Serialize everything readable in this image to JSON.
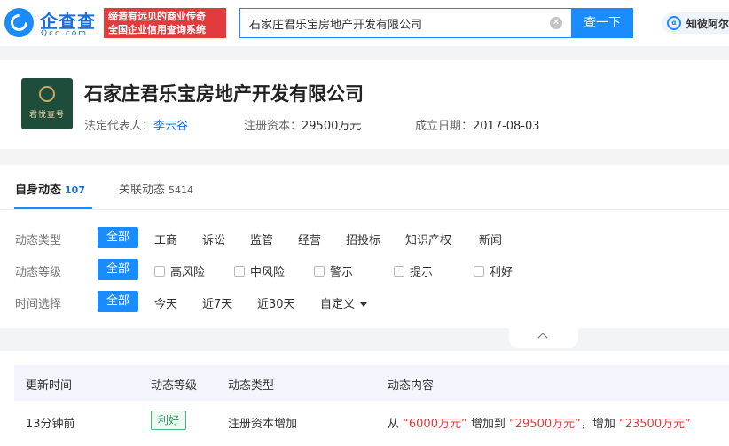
{
  "header": {
    "logo_cn": "企查查",
    "logo_en": "Qcc.com",
    "slogan_line1": "缔造有远见的商业传奇",
    "slogan_line2": "全国企业信用查询系统",
    "search_value": "石家庄君乐宝房地产开发有限公司",
    "search_button": "查一下",
    "zhibi_label": "知彼阿尔法"
  },
  "company": {
    "logo_text": "君悦壹号",
    "name": "石家庄君乐宝房地产开发有限公司",
    "legal_rep_label": "法定代表人：",
    "legal_rep": "李云谷",
    "capital_label": "注册资本：",
    "capital": "29500万元",
    "founded_label": "成立日期：",
    "founded": "2017-08-03"
  },
  "tabs": [
    {
      "label": "自身动态",
      "count": "107"
    },
    {
      "label": "关联动态",
      "count": "5414"
    }
  ],
  "filters": {
    "type": {
      "label": "动态类型",
      "all": "全部",
      "options": [
        "工商",
        "诉讼",
        "监管",
        "经营",
        "招投标",
        "知识产权",
        "新闻"
      ]
    },
    "level": {
      "label": "动态等级",
      "all": "全部",
      "options": [
        "高风险",
        "中风险",
        "警示",
        "提示",
        "利好"
      ]
    },
    "time": {
      "label": "时间选择",
      "all": "全部",
      "options": [
        "今天",
        "近7天",
        "近30天",
        "自定义"
      ]
    }
  },
  "table": {
    "headers": [
      "更新时间",
      "动态等级",
      "动态类型",
      "动态内容"
    ],
    "rows": [
      {
        "time": "13分钟前",
        "level": "利好",
        "type": "注册资本增加",
        "content_prefix": "从",
        "from_value": "“6000万元”",
        "content_mid": "增加到",
        "to_value": "“29500万元”",
        "content_mid2": "，增加",
        "diff_value": "“23500万元”"
      }
    ]
  },
  "colors": {
    "primary": "#1a8cff",
    "slogan_bg": "#e23b3b",
    "positive": "#2e9d5f",
    "highlight": "#e23b3b"
  }
}
